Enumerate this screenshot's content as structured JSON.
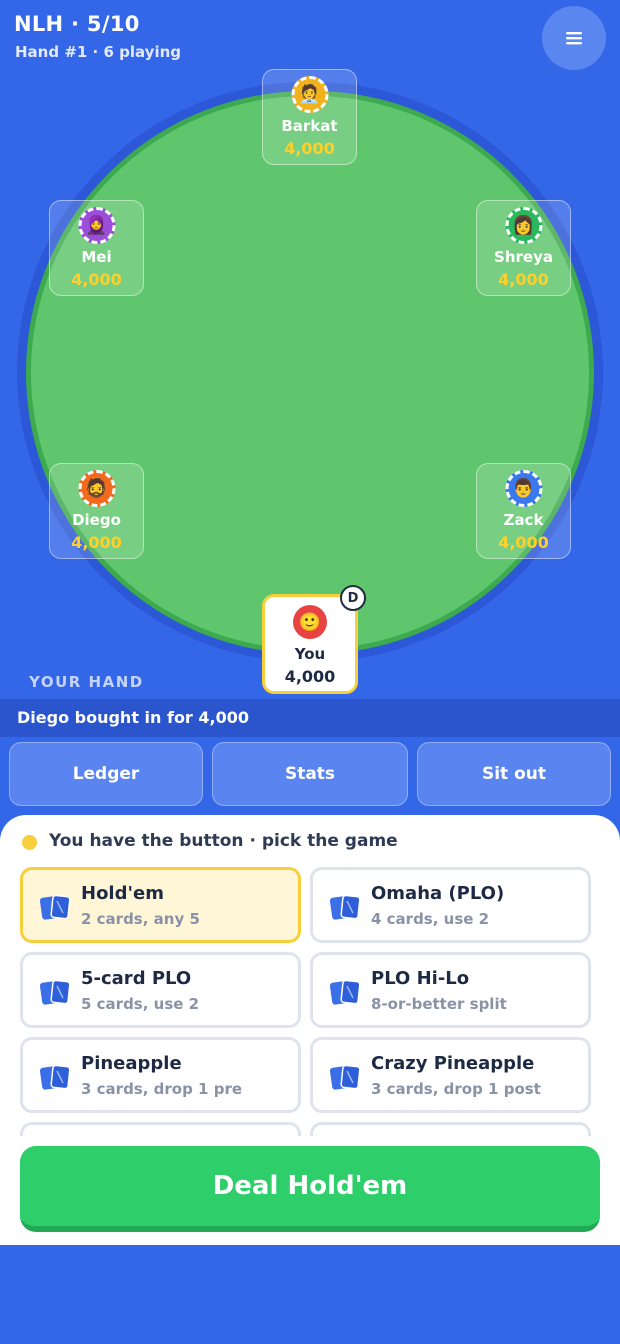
{
  "header": {
    "title": "NLH · 5/10",
    "subtitle": "Hand #1 · 6 playing",
    "menu_icon": "hamburger-menu-icon"
  },
  "colors": {
    "background": "#3466e8",
    "felt": "#5fc66d",
    "chip_gold": "#ffd02a",
    "deal_button": "#2ecf6b"
  },
  "seats": [
    {
      "name": "Barkat",
      "stack": "4,000",
      "avatar": "🧑‍💼",
      "ring_color": "#f2b21b"
    },
    {
      "name": "Mei",
      "stack": "4,000",
      "avatar": "🧕",
      "ring_color": "#9b4fd8"
    },
    {
      "name": "Shreya",
      "stack": "4,000",
      "avatar": "👩",
      "ring_color": "#29b85c"
    },
    {
      "name": "Diego",
      "stack": "4,000",
      "avatar": "🧔",
      "ring_color": "#f26a1b"
    },
    {
      "name": "Zack",
      "stack": "4,000",
      "avatar": "👨",
      "ring_color": "#3a78f0"
    }
  ],
  "you": {
    "name": "You",
    "stack": "4,000",
    "avatar": "🙂",
    "dealer_label": "D"
  },
  "your_hand_label": "YOUR HAND",
  "log": "Diego bought in for 4,000",
  "actions": [
    "Ledger",
    "Stats",
    "Sit out"
  ],
  "game_picker": {
    "title": "You have the button · pick the game",
    "games": [
      {
        "name": "Hold'em",
        "desc": "2 cards, any 5",
        "selected": true
      },
      {
        "name": "Omaha (PLO)",
        "desc": "4 cards, use 2",
        "selected": false
      },
      {
        "name": "5-card PLO",
        "desc": "5 cards, use 2",
        "selected": false
      },
      {
        "name": "PLO Hi-Lo",
        "desc": "8-or-better split",
        "selected": false
      },
      {
        "name": "Pineapple",
        "desc": "3 cards, drop 1 pre",
        "selected": false
      },
      {
        "name": "Crazy Pineapple",
        "desc": "3 cards, drop 1 post",
        "selected": false
      }
    ]
  },
  "deal_button": "Deal Hold'em"
}
